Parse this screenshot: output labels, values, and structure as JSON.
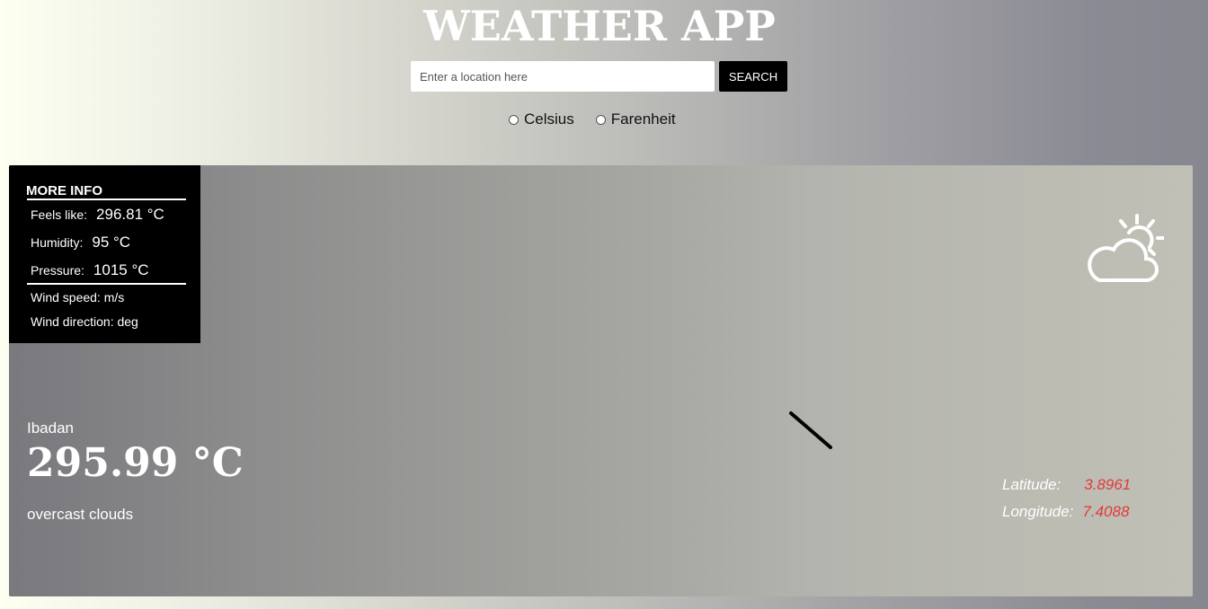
{
  "header": {
    "title": "WEATHER APP"
  },
  "search": {
    "placeholder": "Enter a location here",
    "value": "",
    "button_label": "SEARCH"
  },
  "units": {
    "options": [
      "Celsius",
      "Farenheit"
    ],
    "selected": ""
  },
  "more_info": {
    "title": "MORE INFO",
    "feels_like_label": "Feels like:",
    "feels_like_value": "296.81 °C",
    "humidity_label": "Humidity:",
    "humidity_value": "95 °C",
    "pressure_label": "Pressure:",
    "pressure_value": "1015 °C",
    "wind_speed": "Wind speed: m/s",
    "wind_direction": "Wind direction: deg"
  },
  "current": {
    "city": "Ibadan",
    "temperature": "295.99 °C",
    "description": "overcast clouds",
    "icon": "partly-cloudy-icon"
  },
  "location": {
    "latitude_label": "Latitude:",
    "latitude_value": "3.8961",
    "longitude_label": "Longitude:",
    "longitude_value": "7.4088"
  },
  "colors": {
    "coordinate_value": "#e03a3a",
    "panel_background": "#000000",
    "text_light": "#ffffff"
  }
}
